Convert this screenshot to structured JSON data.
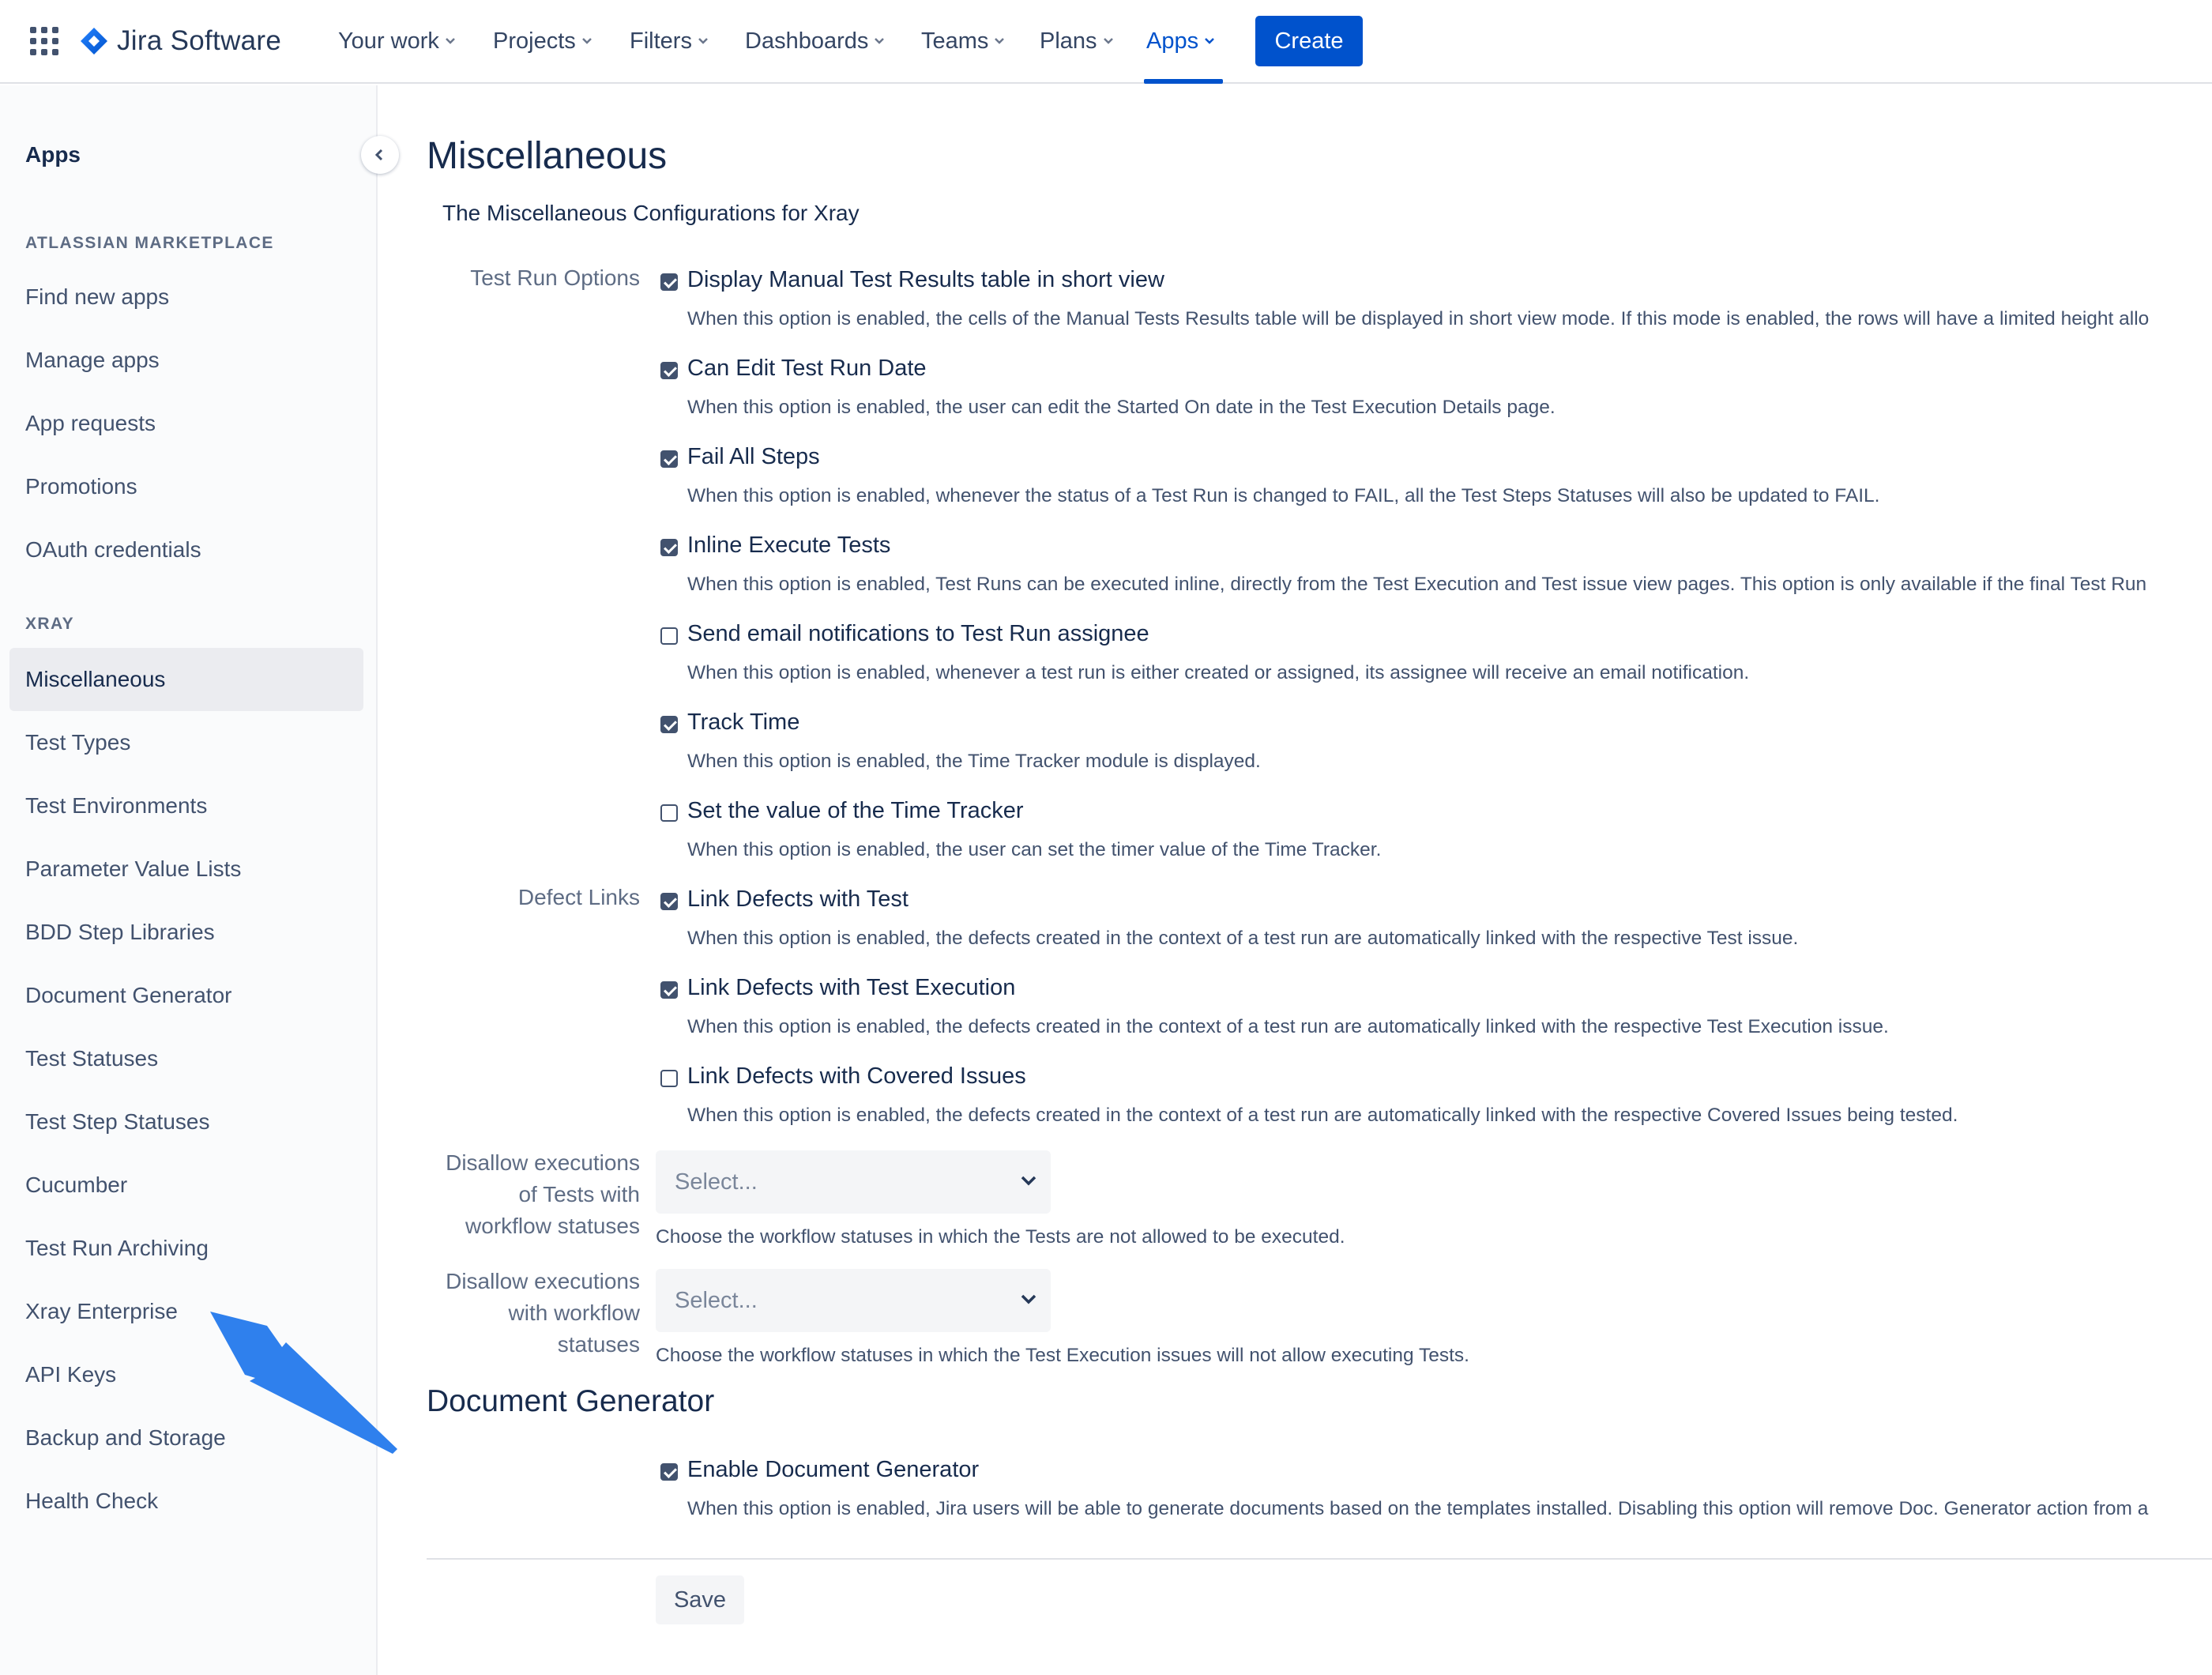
{
  "topnav": {
    "logo_text": "Jira Software",
    "items": [
      {
        "label": "Your work"
      },
      {
        "label": "Projects"
      },
      {
        "label": "Filters"
      },
      {
        "label": "Dashboards"
      },
      {
        "label": "Teams"
      },
      {
        "label": "Plans"
      },
      {
        "label": "Apps",
        "active": true
      }
    ],
    "create_label": "Create",
    "accent_color": "#0052CC"
  },
  "sidebar": {
    "title": "Apps",
    "sections": [
      {
        "heading": "ATLASSIAN MARKETPLACE",
        "items": [
          "Find new apps",
          "Manage apps",
          "App requests",
          "Promotions",
          "OAuth credentials"
        ]
      },
      {
        "heading": "XRAY",
        "items": [
          "Miscellaneous",
          "Test Types",
          "Test Environments",
          "Parameter Value Lists",
          "BDD Step Libraries",
          "Document Generator",
          "Test Statuses",
          "Test Step Statuses",
          "Cucumber",
          "Test Run Archiving",
          "Xray Enterprise",
          "API Keys",
          "Backup and Storage",
          "Health Check"
        ]
      }
    ],
    "selected": "Miscellaneous"
  },
  "main": {
    "title": "Miscellaneous",
    "description": "The Miscellaneous Configurations for Xray",
    "groups": {
      "test_run_options": "Test Run Options",
      "defect_links": "Defect Links"
    },
    "options": [
      {
        "label": "Display Manual Test Results table in short view",
        "checked": true,
        "desc": "When this option is enabled, the cells of the Manual Tests Results table will be displayed in short view mode. If this mode is enabled, the rows will have a limited height allo"
      },
      {
        "label": "Can Edit Test Run Date",
        "checked": true,
        "desc": "When this option is enabled, the user can edit the Started On date in the Test Execution Details page."
      },
      {
        "label": "Fail All Steps",
        "checked": true,
        "desc": "When this option is enabled, whenever the status of a Test Run is changed to FAIL, all the Test Steps Statuses will also be updated to FAIL."
      },
      {
        "label": "Inline Execute Tests",
        "checked": true,
        "desc": "When this option is enabled, Test Runs can be executed inline, directly from the Test Execution and Test issue view pages. This option is only available if the final Test Run"
      },
      {
        "label": "Send email notifications to Test Run assignee",
        "checked": false,
        "desc": "When this option is enabled, whenever a test run is either created or assigned, its assignee will receive an email notification."
      },
      {
        "label": "Track Time",
        "checked": true,
        "desc": "When this option is enabled, the Time Tracker module is displayed."
      },
      {
        "label": "Set the value of the Time Tracker",
        "checked": false,
        "desc": "When this option is enabled, the user can set the timer value of the Time Tracker."
      },
      {
        "label": "Link Defects with Test",
        "checked": true,
        "desc": "When this option is enabled, the defects created in the context of a test run are automatically linked with the respective Test issue."
      },
      {
        "label": "Link Defects with Test Execution",
        "checked": true,
        "desc": "When this option is enabled, the defects created in the context of a test run are automatically linked with the respective Test Execution issue."
      },
      {
        "label": "Link Defects with Covered Issues",
        "checked": false,
        "desc": "When this option is enabled, the defects created in the context of a test run are automatically linked with the respective Covered Issues being tested."
      }
    ],
    "selects": [
      {
        "label_lines": [
          "Disallow executions",
          "of Tests with",
          "workflow statuses"
        ],
        "placeholder": "Select...",
        "help": "Choose the workflow statuses in which the Tests are not allowed to be executed."
      },
      {
        "label_lines": [
          "Disallow executions",
          "with workflow",
          "statuses"
        ],
        "placeholder": "Select...",
        "help": "Choose the workflow statuses in which the Test Execution issues will not allow executing Tests."
      }
    ],
    "doc_generator": {
      "title": "Document Generator",
      "option": {
        "label": "Enable Document Generator",
        "checked": true,
        "desc": "When this option is enabled, Jira users will be able to generate documents based on the templates installed. Disabling this option will remove Doc. Generator action from a"
      }
    },
    "save_label": "Save"
  },
  "annotation": {
    "arrow_color": "#2F80ED"
  }
}
